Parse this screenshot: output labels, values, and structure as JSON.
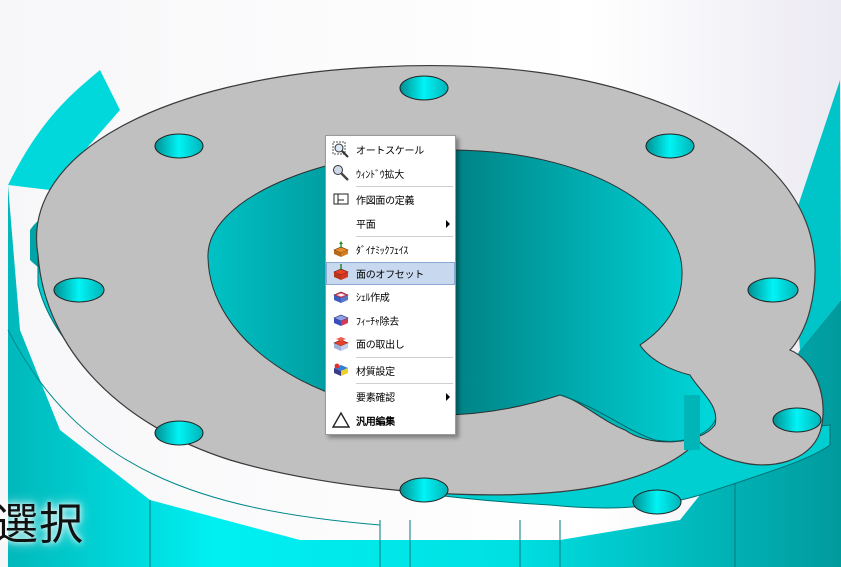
{
  "caption": "選択",
  "colors": {
    "cad_surface": "#00e6e8",
    "cad_surface_dark": "#00a8ab",
    "flange_top": "#c0c0c0",
    "menu_highlight": "#c8d9ef"
  },
  "context_menu": {
    "items": [
      {
        "label": "オートスケール",
        "icon": "auto-scale-icon"
      },
      {
        "label": "ｳｨﾝﾄﾞｳ拡大",
        "icon": "window-zoom-icon"
      },
      {
        "label": "作図面の定義",
        "icon": "define-workplane-icon"
      },
      {
        "label": "平面",
        "icon": "",
        "submenu": true
      },
      {
        "label": "ﾀﾞｲﾅﾐｯｸﾌｪｲｽ",
        "icon": "dynamic-face-icon"
      },
      {
        "label": "面のオフセット",
        "icon": "face-offset-icon",
        "selected": true
      },
      {
        "label": "ｼｪﾙ作成",
        "icon": "shell-create-icon"
      },
      {
        "label": "ﾌｨｰﾁｬ除去",
        "icon": "feature-remove-icon"
      },
      {
        "label": "面の取出し",
        "icon": "face-extract-icon"
      },
      {
        "label": "材質設定",
        "icon": "material-setting-icon"
      },
      {
        "label": "要素確認",
        "icon": "",
        "submenu": true
      },
      {
        "label": "汎用編集",
        "icon": "general-edit-icon"
      }
    ]
  }
}
